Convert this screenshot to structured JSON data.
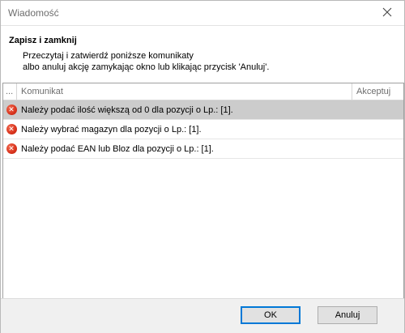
{
  "window": {
    "title": "Wiadomość"
  },
  "header": {
    "title": "Zapisz i zamknij",
    "line1": "Przeczytaj i zatwierdź poniższe komunikaty",
    "line2": "albo anuluj akcję zamykając okno lub klikając przycisk 'Anuluj'."
  },
  "grid": {
    "columns": {
      "dots": "...",
      "message": "Komunikat",
      "accept": "Akceptuj"
    },
    "rows": [
      {
        "icon": "error-icon",
        "message": "Należy podać ilość większą od 0 dla pozycji o Lp.: [1].",
        "selected": true
      },
      {
        "icon": "error-icon",
        "message": "Należy wybrać magazyn dla pozycji o Lp.: [1].",
        "selected": false
      },
      {
        "icon": "error-icon",
        "message": "Należy podać EAN lub Bloz dla pozycji o Lp.: [1].",
        "selected": false
      }
    ]
  },
  "buttons": {
    "ok": "OK",
    "cancel": "Anuluj"
  },
  "colors": {
    "selected_row": "#cccccc",
    "error": "#d8321c",
    "focus_border": "#0078d7"
  }
}
